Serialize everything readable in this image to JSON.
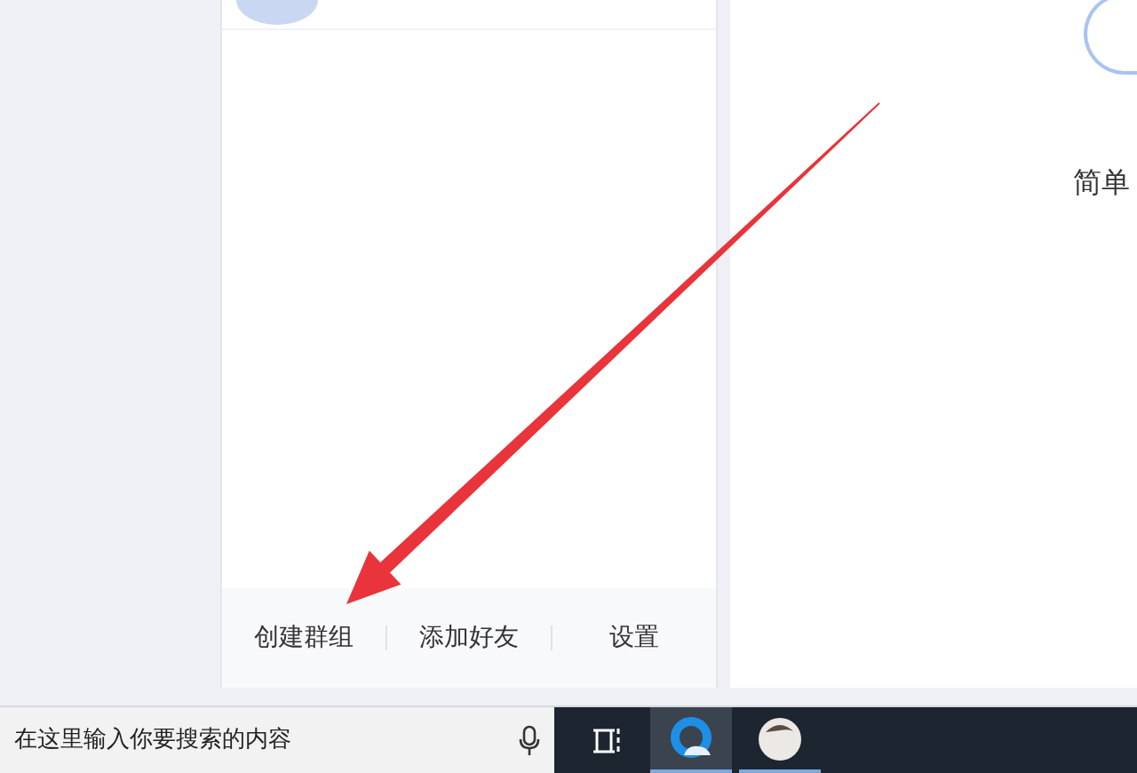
{
  "left_panel": {
    "footer_actions": [
      {
        "label": "创建群组"
      },
      {
        "label": "添加好友"
      },
      {
        "label": "设置"
      }
    ]
  },
  "right_panel": {
    "text": "简单"
  },
  "taskbar": {
    "search": {
      "placeholder": "在这里输入你要搜索的内容"
    },
    "apps": [
      {
        "kind": "browser",
        "selected": true
      },
      {
        "kind": "avatar",
        "selected": false
      }
    ]
  }
}
